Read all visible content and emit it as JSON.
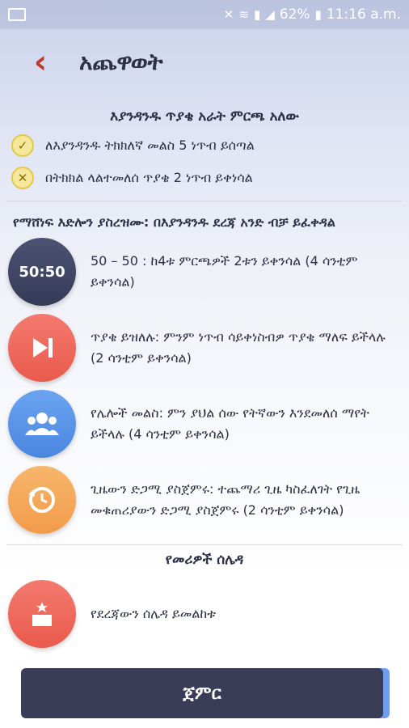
{
  "statusbar": {
    "battery": "62%",
    "time": "11:16 a.m."
  },
  "header": {
    "back_icon": "‹",
    "title": "አጨዋወት"
  },
  "rules": {
    "heading": "እያንዳንዱ ጥያቄ አራት ምርጫ አለው",
    "items": [
      {
        "icon": "check-circle-icon",
        "text": "ለእያንዳንዱ ትክክለኛ መልስ 5 ነጥብ ይሰጣል"
      },
      {
        "icon": "x-circle-icon",
        "text": "በትክክል ላልተመለሰ ጥያቄ 2 ነጥብ ይቀነሳል"
      }
    ]
  },
  "lifelines": {
    "heading": "የማሸነፍ እድሎን ያስረዝሙ: በእያንዳንዱ ደረጃ አንድ ብቻ ይፈቀዳል",
    "items": [
      {
        "label": "50:50",
        "text": "50 – 50 : ከ4ቱ ምርጫዎች 2ቱን ይቀንሳል (4 ሳንቲም ይቀንሳል)"
      },
      {
        "icon": "skip-icon",
        "text": "ጥያቄ ይዝለሉ: ምንም ነጥብ ሳይቀነስብዎ ጥያቄ ማለፍ ይችላሉ (2 ሳንቲም ይቀንሳል)"
      },
      {
        "icon": "audience-icon",
        "text": "የሌሎች መልስ: ምን ያህል ሰው የትኛውን እንደመለሰ ማየት ይችላሉ (4 ሳንቲም ይቀንሳል)"
      },
      {
        "icon": "timer-icon",
        "text": "ጊዜውን ድጋሚ ያስጀምሩ: ተጨማሪ ጊዜ ካስፈለገት የጊዜ መቁጠሪያውን ድጋሚ ያስጀምሩ (2 ሳንቲም ይቀንሳል)"
      }
    ]
  },
  "leaderboard": {
    "heading": "የመሪዎች ሰሌዳ",
    "text": "የደረጃውን ሰሌዳ ይመልከቱ"
  },
  "start_button": "ጀምር",
  "colors": {
    "accent_dark": "#3a3d57",
    "red": "#e95a4d",
    "blue": "#4a86e0",
    "orange": "#f29b4a"
  }
}
